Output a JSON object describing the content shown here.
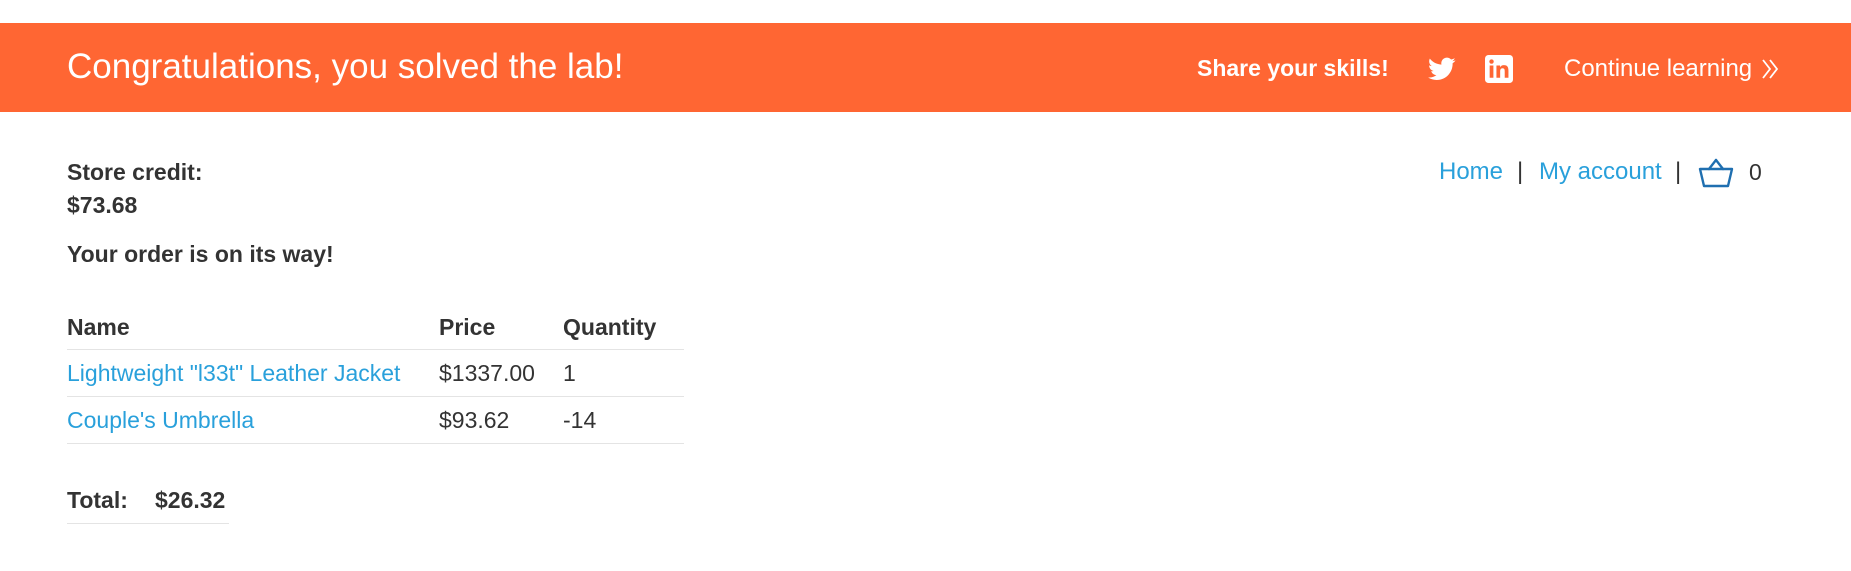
{
  "banner": {
    "title": "Congratulations, you solved the lab!",
    "share_label": "Share your skills!",
    "continue_label": "Continue learning",
    "background_color": "#ff6633",
    "icons": [
      "twitter-icon",
      "linkedin-icon",
      "double-chevron-right-icon"
    ]
  },
  "nav": {
    "home": "Home",
    "separator": "|",
    "my_account": "My account",
    "cart_icon": "basket-icon",
    "cart_count": "0"
  },
  "store_credit": {
    "label": "Store credit:",
    "value": "$73.68"
  },
  "order_message": "Your order is on its way!",
  "table": {
    "headers": {
      "name": "Name",
      "price": "Price",
      "quantity": "Quantity"
    },
    "rows": [
      {
        "name": "Lightweight \"l33t\" Leather Jacket",
        "price": "$1337.00",
        "quantity": "1"
      },
      {
        "name": "Couple's Umbrella",
        "price": "$93.62",
        "quantity": "-14"
      }
    ]
  },
  "total": {
    "label": "Total:",
    "value": "$26.32"
  },
  "colors": {
    "accent_orange": "#ff6633",
    "link_blue": "#29a0db",
    "text": "#333333"
  }
}
